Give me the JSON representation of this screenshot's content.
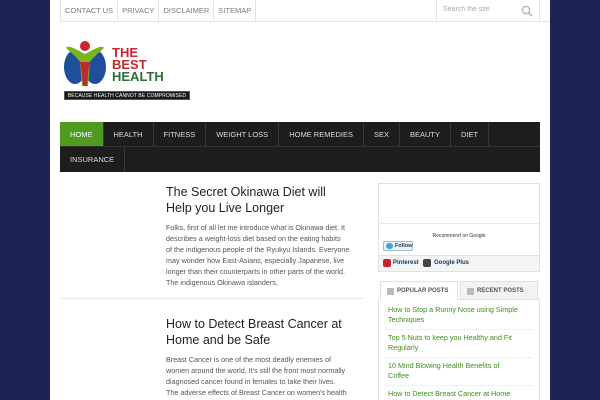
{
  "top_links": [
    "CONTACT US",
    "PRIVACY",
    "DISCLAIMER",
    "SITEMAP"
  ],
  "search": {
    "placeholder": "Search the site"
  },
  "logo": {
    "line1": "THE",
    "line2": "BEST",
    "line3": "HEALTH",
    "tagline": "BECAUSE HEALTH CANNOT BE COMPROMISED"
  },
  "nav": {
    "row1": [
      "HOME",
      "HEALTH",
      "FITNESS",
      "WEIGHT LOSS",
      "HOME REMEDIES",
      "SEX",
      "BEAUTY",
      "DIET"
    ],
    "row2": [
      "INSURANCE"
    ],
    "active": "HOME"
  },
  "posts": [
    {
      "title_lines": [
        "The Secret Okinawa Diet will",
        "Help you Live Longer"
      ],
      "excerpt_lines": [
        "Folks, first of all let me introduce what is Okinawa diet. It",
        "describes a weight-loss diet based on the eating habits",
        "of the indigenous people of the Ryukyu Islands. Everyone",
        "may wonder how East-Asians, especially Japanese, live",
        "longer than their counterparts in other parts of the world.",
        "The indigenous Okinawa islanders,"
      ]
    },
    {
      "title_lines": [
        "How to Detect Breast Cancer at",
        "Home and be Safe"
      ],
      "excerpt_lines": [
        "Breast Cancer is one of the most deadly enemies of",
        "women around the world. It's still the front most normally",
        "diagnosed cancer found in females to take their lives.",
        "The adverse effects of Breast Cancer on women's health"
      ]
    }
  ],
  "sidebar": {
    "recommend": "Recommend on Google",
    "follow": "Follow",
    "pinterest": "Pinterest",
    "google_plus": "Google Plus",
    "tabs": [
      "POPULAR POSTS",
      "RECENT POSTS"
    ],
    "popular_posts": [
      [
        "How to Stop a Runny Nose using Simple",
        "Techniques"
      ],
      [
        "Top 5 Nuts to keep you Healthy and Fit",
        "Regularly"
      ],
      [
        "10 Mind Blowing Health Benefits of",
        "Coffee"
      ],
      [
        "How to Detect Breast Cancer at Home",
        ""
      ]
    ]
  },
  "colors": {
    "background": "#1f2354",
    "nav_bg": "#1d1d1d",
    "nav_active": "#4f9b1f",
    "link_green": "#3f8e1c",
    "logo_red": "#c2282f",
    "logo_green": "#2c6e36"
  }
}
